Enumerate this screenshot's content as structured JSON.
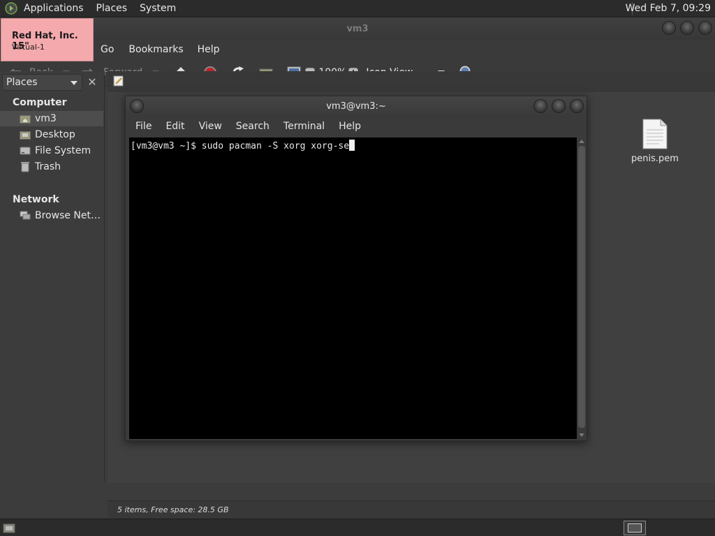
{
  "top_panel": {
    "menus": [
      "Applications",
      "Places",
      "System"
    ],
    "clock": "Wed Feb  7, 09:29"
  },
  "notification": {
    "title": "Red Hat, Inc. 15\"",
    "subtitle": "Virtual-1"
  },
  "file_manager": {
    "title": "vm3",
    "menus": [
      "Go",
      "Bookmarks",
      "Help"
    ],
    "toolbar": {
      "back_label": "Back",
      "forward_label": "Forward",
      "zoom_level": "100%",
      "view_mode": "Icon View"
    },
    "sidepane": {
      "header": "Places",
      "groups": [
        {
          "label": "Computer",
          "items": [
            "vm3",
            "Desktop",
            "File System",
            "Trash"
          ]
        },
        {
          "label": "Network",
          "items": [
            "Browse Net…"
          ]
        }
      ]
    },
    "files": [
      {
        "name": "penis.pem",
        "icon": "text-file-icon"
      }
    ],
    "status": "5 items, Free space: 28.5 GB"
  },
  "terminal": {
    "title": "vm3@vm3:~",
    "menus": [
      "File",
      "Edit",
      "View",
      "Search",
      "Terminal",
      "Help"
    ],
    "prompt_line": "[vm3@vm3 ~]$ sudo pacman -S xorg xorg-se"
  },
  "colors": {
    "notification_bg": "#f4a9ad",
    "panel_bg": "#2b2b2b",
    "window_bg": "#3c3c3c",
    "terminal_bg": "#000000",
    "stop_red": "#c0232b"
  }
}
